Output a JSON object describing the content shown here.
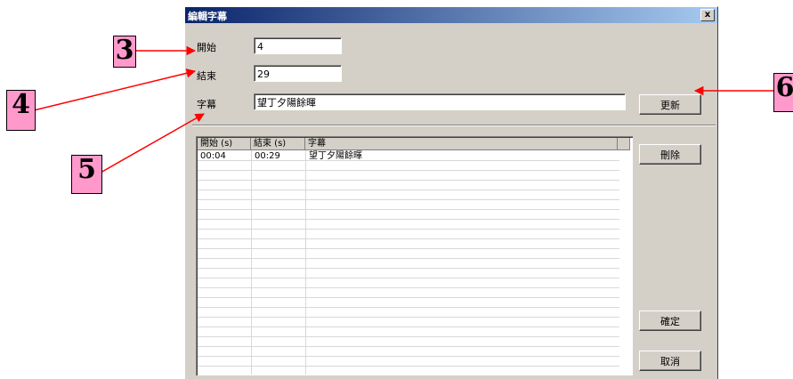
{
  "dialog": {
    "title": "編輯字幕",
    "close_glyph": "x"
  },
  "form": {
    "start_label": "開始",
    "start_value": "4",
    "end_label": "結束",
    "end_value": "29",
    "subtitle_label": "字幕",
    "subtitle_value": "望丁夕陽餘暉"
  },
  "buttons": {
    "update": "更新",
    "delete": "刪除",
    "ok": "確定",
    "cancel": "取消"
  },
  "table": {
    "headers": [
      "開始 (s)",
      "結束 (s)",
      "字幕"
    ],
    "rows": [
      [
        "00:04",
        "00:29",
        "望丁夕陽餘暉"
      ]
    ]
  },
  "callouts": [
    "3",
    "4",
    "5",
    "6"
  ],
  "colors": {
    "callout_fill": "#ff99cc",
    "arrow": "#ff0000",
    "title_start": "#0a246a",
    "title_end": "#a6caf0"
  }
}
